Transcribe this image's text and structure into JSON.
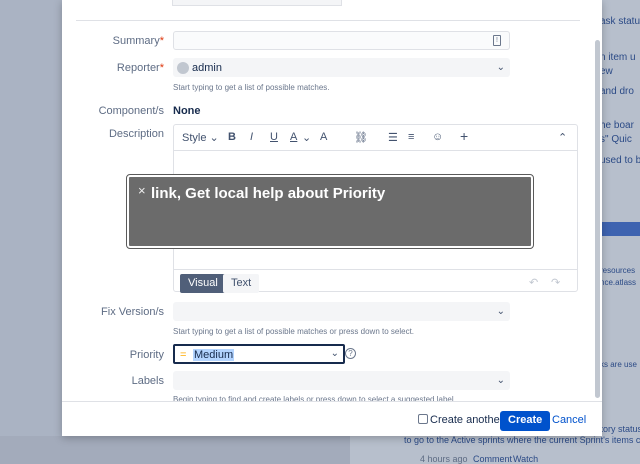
{
  "background": {
    "right_snippets": [
      "ask statu",
      "n item u",
      "ew",
      "and dro",
      "he boar",
      "s\" Quic",
      "used to b",
      "resources",
      "nce.atlass",
      "ks are use"
    ],
    "bottom_lines": [
      "istory status",
      "to go to the Active sprints where the current Sprint's items can be c"
    ],
    "meta": {
      "time": "4 hours ago",
      "comment": "Comment",
      "watch": "Watch"
    }
  },
  "form": {
    "summary": {
      "label": "Summary",
      "required": "*",
      "value": ""
    },
    "reporter": {
      "label": "Reporter",
      "required": "*",
      "value": "admin",
      "hint": "Start typing to get a list of possible matches."
    },
    "components": {
      "label": "Component/s",
      "value": "None"
    },
    "description": {
      "label": "Description",
      "toolbar": {
        "style": "Style",
        "bold": "B",
        "italic": "I",
        "underline": "U",
        "color": "A",
        "more": "A",
        "link": "🔗",
        "bullets": "☰",
        "numbered": "≡",
        "emoji": "☺",
        "insert": "+",
        "collapse": "⌃"
      },
      "tabs": {
        "visual": "Visual",
        "text": "Text"
      }
    },
    "fix_version": {
      "label": "Fix Version/s",
      "value": "",
      "hint": "Start typing to get a list of possible matches or press down to select."
    },
    "priority": {
      "label": "Priority",
      "value": "Medium",
      "help": "?"
    },
    "labels": {
      "label": "Labels",
      "value": "",
      "hint": "Begin typing to find and create labels or press down to select a suggested label."
    }
  },
  "tooltip": {
    "close": "×",
    "text": "link, Get local help about Priority"
  },
  "footer": {
    "create_another": "Create another",
    "create": "Create",
    "cancel": "Cancel"
  },
  "colors": {
    "primary": "#0052cc",
    "tooltip_bg": "#6b6b6b",
    "priority_medium": "#ffab00"
  }
}
